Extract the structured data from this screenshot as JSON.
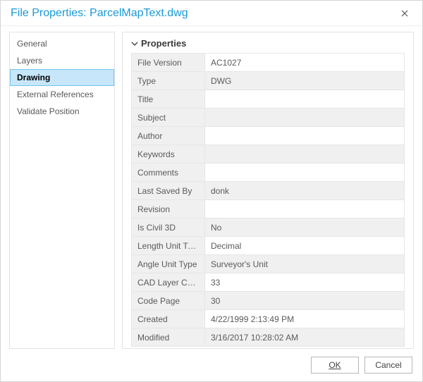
{
  "dialog": {
    "title": "File Properties: ParcelMapText.dwg"
  },
  "sidebar": {
    "items": [
      {
        "label": "General",
        "selected": false
      },
      {
        "label": "Layers",
        "selected": false
      },
      {
        "label": "Drawing",
        "selected": true
      },
      {
        "label": "External References",
        "selected": false
      },
      {
        "label": "Validate Position",
        "selected": false
      }
    ]
  },
  "section": {
    "title": "Properties",
    "expanded": true
  },
  "properties": [
    {
      "key": "File Version",
      "value": "AC1027"
    },
    {
      "key": "Type",
      "value": "DWG"
    },
    {
      "key": "Title",
      "value": ""
    },
    {
      "key": "Subject",
      "value": ""
    },
    {
      "key": "Author",
      "value": ""
    },
    {
      "key": "Keywords",
      "value": ""
    },
    {
      "key": "Comments",
      "value": ""
    },
    {
      "key": "Last Saved By",
      "value": "donk"
    },
    {
      "key": "Revision",
      "value": ""
    },
    {
      "key": "Is Civil 3D",
      "value": "No"
    },
    {
      "key": "Length Unit Type",
      "value": "Decimal"
    },
    {
      "key": "Angle Unit Type",
      "value": "Surveyor's Unit"
    },
    {
      "key": "CAD Layer Count",
      "value": "33"
    },
    {
      "key": "Code Page",
      "value": "30"
    },
    {
      "key": "Created",
      "value": "4/22/1999 2:13:49 PM"
    },
    {
      "key": "Modified",
      "value": "3/16/2017 10:28:02 AM"
    }
  ],
  "buttons": {
    "ok": "OK",
    "cancel": "Cancel"
  }
}
